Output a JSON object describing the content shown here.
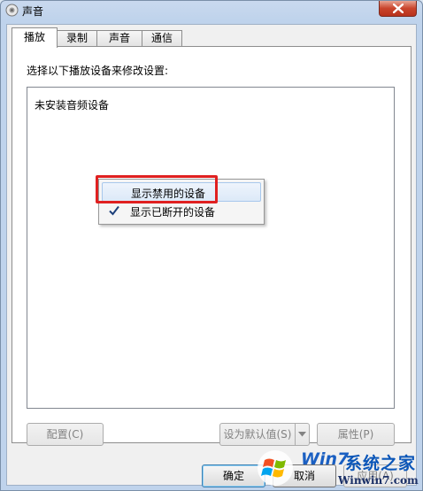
{
  "window": {
    "title": "声音",
    "close_icon": "close-icon",
    "app_icon": "speaker-icon"
  },
  "tabs": [
    {
      "label": "播放",
      "active": true
    },
    {
      "label": "录制",
      "active": false
    },
    {
      "label": "声音",
      "active": false
    },
    {
      "label": "通信",
      "active": false
    }
  ],
  "playback": {
    "instruction": "选择以下播放设备来修改设置:",
    "empty_message": "未安装音频设备"
  },
  "context_menu": {
    "items": [
      {
        "label": "显示禁用的设备",
        "checked": false,
        "hovered": true
      },
      {
        "label": "显示已断开的设备",
        "checked": true,
        "hovered": false
      }
    ],
    "highlight_color": "#e02020"
  },
  "buttons": {
    "configure": "配置(C)",
    "set_default": "设为默认值(S)",
    "properties": "属性(P)",
    "ok": "确定",
    "cancel": "取消",
    "apply": "应用(A)"
  },
  "watermark": {
    "brand": "Win7",
    "site_name": "系统之家",
    "url": "Winwin7.com"
  }
}
